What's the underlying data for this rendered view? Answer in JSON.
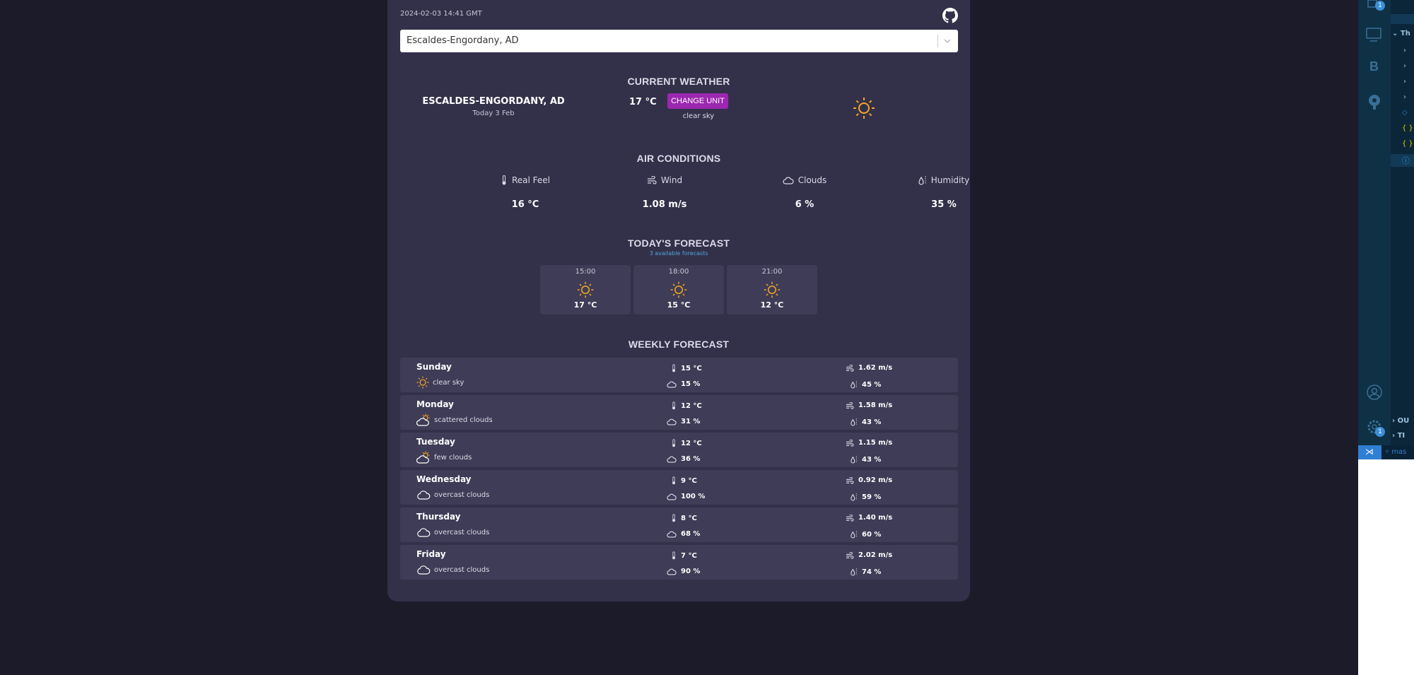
{
  "app": {
    "datetime": "2024-02-03 14:41 GMT",
    "github_icon": "github-icon"
  },
  "search": {
    "value": "Escaldes-Engordany, AD"
  },
  "current": {
    "title": "CURRENT WEATHER",
    "city": "ESCALDES-ENGORDANY, AD",
    "date": "Today 3 Feb",
    "temp": "17 °C",
    "change_unit_label": "CHANGE UNIT",
    "description": "clear sky",
    "icon": "sun-icon",
    "accent_color": "#9c27b0",
    "sun_color": "#f5a623"
  },
  "air": {
    "title": "AIR CONDITIONS",
    "items": [
      {
        "label": "Real Feel",
        "value": "16 °C",
        "icon": "thermometer-icon"
      },
      {
        "label": "Wind",
        "value": "1.08 m/s",
        "icon": "wind-icon"
      },
      {
        "label": "Clouds",
        "value": "6 %",
        "icon": "cloud-icon"
      },
      {
        "label": "Humidity",
        "value": "35 %",
        "icon": "humidity-icon"
      }
    ]
  },
  "today": {
    "title": "TODAY'S FORECAST",
    "subtitle": "3 available forecasts",
    "subtitle_color": "#4fa8d8",
    "items": [
      {
        "time": "15:00",
        "temp": "17 °C",
        "icon": "sun-icon"
      },
      {
        "time": "18:00",
        "temp": "15 °C",
        "icon": "sun-icon"
      },
      {
        "time": "21:00",
        "temp": "12 °C",
        "icon": "sun-icon"
      }
    ]
  },
  "weekly": {
    "title": "WEEKLY FORECAST",
    "days": [
      {
        "day": "Sunday",
        "desc": "clear sky",
        "icon": "sun-icon",
        "temp": "15 °C",
        "wind": "1.62 m/s",
        "clouds": "15 %",
        "humidity": "45 %"
      },
      {
        "day": "Monday",
        "desc": "scattered clouds",
        "icon": "cloud-sun-icon",
        "temp": "12 °C",
        "wind": "1.58 m/s",
        "clouds": "31 %",
        "humidity": "43 %"
      },
      {
        "day": "Tuesday",
        "desc": "few clouds",
        "icon": "cloud-sun-icon",
        "temp": "12 °C",
        "wind": "1.15 m/s",
        "clouds": "36 %",
        "humidity": "43 %"
      },
      {
        "day": "Wednesday",
        "desc": "overcast clouds",
        "icon": "cloud-icon",
        "temp": "9 °C",
        "wind": "0.92 m/s",
        "clouds": "100 %",
        "humidity": "59 %"
      },
      {
        "day": "Thursday",
        "desc": "overcast clouds",
        "icon": "cloud-icon",
        "temp": "8 °C",
        "wind": "1.40 m/s",
        "clouds": "68 %",
        "humidity": "60 %"
      },
      {
        "day": "Friday",
        "desc": "overcast clouds",
        "icon": "cloud-icon",
        "temp": "7 °C",
        "wind": "2.02 m/s",
        "clouds": "90 %",
        "humidity": "74 %"
      }
    ]
  },
  "vscode": {
    "badge_top": "1",
    "badge_settings": "1",
    "tree_labels": [
      "Th",
      "OU",
      "TI"
    ],
    "branch": "mas"
  }
}
